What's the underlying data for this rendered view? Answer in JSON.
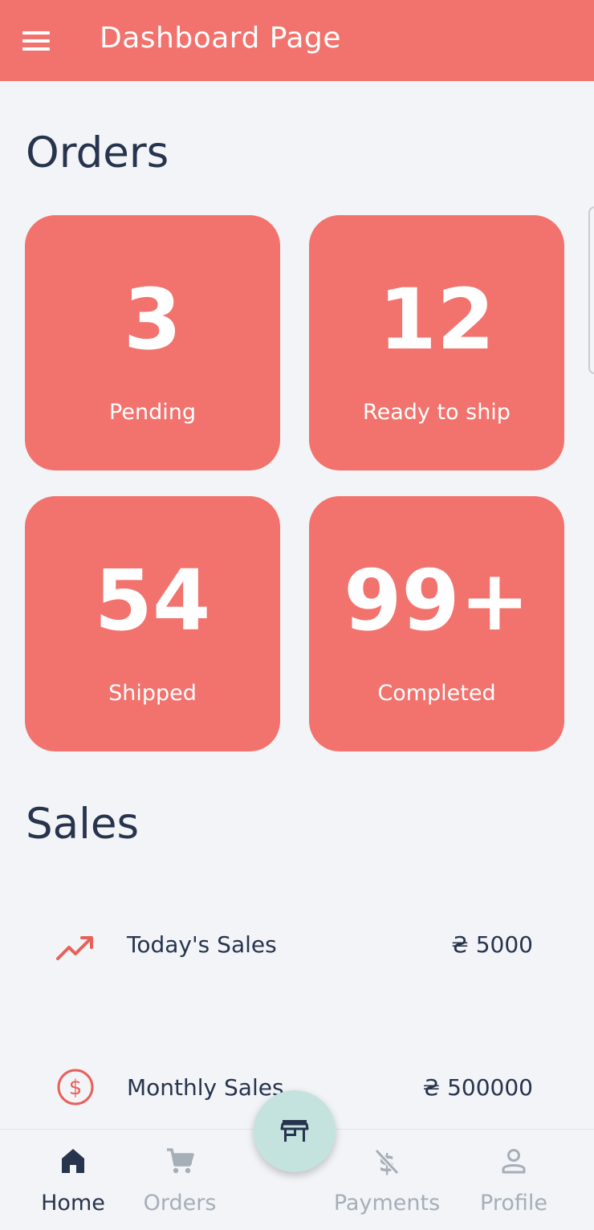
{
  "app_bar": {
    "title": "Dashboard Page",
    "background_color": "#f2736d",
    "menu_icon": "menu-icon"
  },
  "orders": {
    "section_title": "Orders",
    "cards": [
      {
        "count": "3",
        "label": "Pending"
      },
      {
        "count": "12",
        "label": "Ready to ship"
      },
      {
        "count": "54",
        "label": "Shipped"
      },
      {
        "count": "99+",
        "label": "Completed"
      }
    ]
  },
  "sales": {
    "section_title": "Sales",
    "items": [
      {
        "icon": "trending-up-icon",
        "label": "Today's Sales",
        "value": "₴ 5000"
      },
      {
        "icon": "dollar-circle-icon",
        "label": "Monthly Sales",
        "value": "₴ 500000"
      }
    ]
  },
  "fab": {
    "icon": "store-icon",
    "color": "#c5e3de"
  },
  "bottom_nav": {
    "active_color": "#27344d",
    "inactive_color": "#a6aeb8",
    "items": [
      {
        "icon": "home-icon",
        "label": "Home",
        "active": true
      },
      {
        "icon": "cart-icon",
        "label": "Orders",
        "active": false
      },
      {
        "icon": "dollar-off-icon",
        "label": "Payments",
        "active": false
      },
      {
        "icon": "person-icon",
        "label": "Profile",
        "active": false
      }
    ]
  }
}
